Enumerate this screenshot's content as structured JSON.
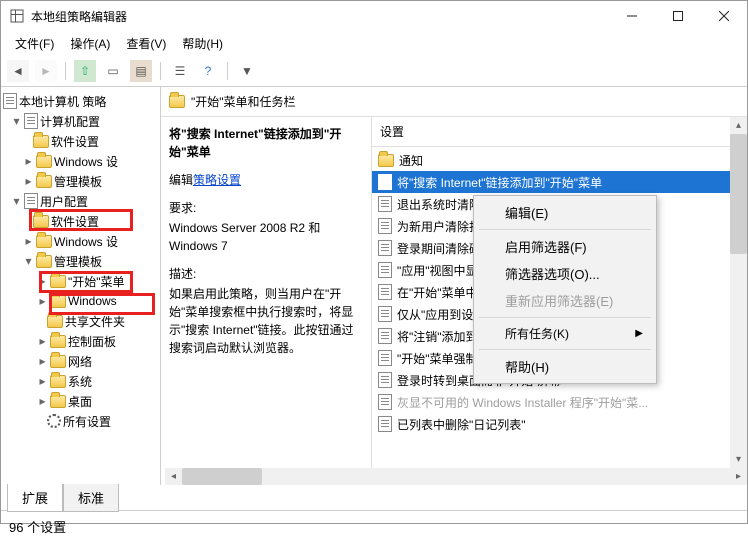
{
  "window": {
    "title": "本地组策略编辑器"
  },
  "menu": {
    "file": "文件(F)",
    "action": "操作(A)",
    "view": "查看(V)",
    "help": "帮助(H)"
  },
  "tree": {
    "root": "本地计算机 策略",
    "computer": "计算机配置",
    "c_soft": "软件设置",
    "c_win": "Windows 设",
    "c_admin": "管理模板",
    "user": "用户配置",
    "u_soft": "软件设置",
    "u_win": "Windows 设",
    "u_admin": "管理模板",
    "u_start": "\"开始\"菜单",
    "u_windows": "Windows",
    "u_share": "共享文件夹",
    "u_cp": "控制面板",
    "u_net": "网络",
    "u_sys": "系统",
    "u_desk": "桌面",
    "u_all": "所有设置"
  },
  "content": {
    "header": "\"开始\"菜单和任务栏",
    "desc_title": "将\"搜索 Internet\"链接添加到\"开始\"菜单",
    "edit_prefix": "编辑",
    "edit_link": "策略设置",
    "req_label": "要求:",
    "req_text": "Windows Server 2008 R2 和 Windows 7",
    "desc_label": "描述:",
    "desc_text": "如果启用此策略，则当用户在\"开始\"菜单搜索框中执行搜索时，将显示\"搜索 Internet\"链接。此按钮通过搜索词启动默认浏览器。"
  },
  "list": {
    "header": "设置",
    "notify": "通知",
    "items": [
      "将\"搜索 Internet\"链接添加到\"开始\"菜单",
      "退出系统时清除最近打开的文档的历史",
      "为新用户清除打开的程序的历史",
      "登录期间清除磁贴通知",
      "\"应用\"视图中显示开始中的所有程序",
      "在\"开始\"菜单中显示\"运行\"或在工作",
      "仅从\"应用到设备\"列表中选择应用",
      "将\"注销\"添加到\"开始\"菜单",
      "\"开始\"菜单强制为全屏大小或菜单大小",
      "登录时转到桌面而非\"开始\"屏幕",
      "灰显不可用的 Windows Installer 程序\"开始\"菜...",
      "已列表中删除\"日记列表\""
    ]
  },
  "context": {
    "edit": "编辑(E)",
    "filter": "启用筛选器(F)",
    "options": "筛选器选项(O)...",
    "reapply": "重新应用筛选器(E)",
    "tasks": "所有任务(K)",
    "help": "帮助(H)"
  },
  "tabs": {
    "ext": "扩展",
    "std": "标准"
  },
  "status": {
    "text": "96 个设置"
  }
}
